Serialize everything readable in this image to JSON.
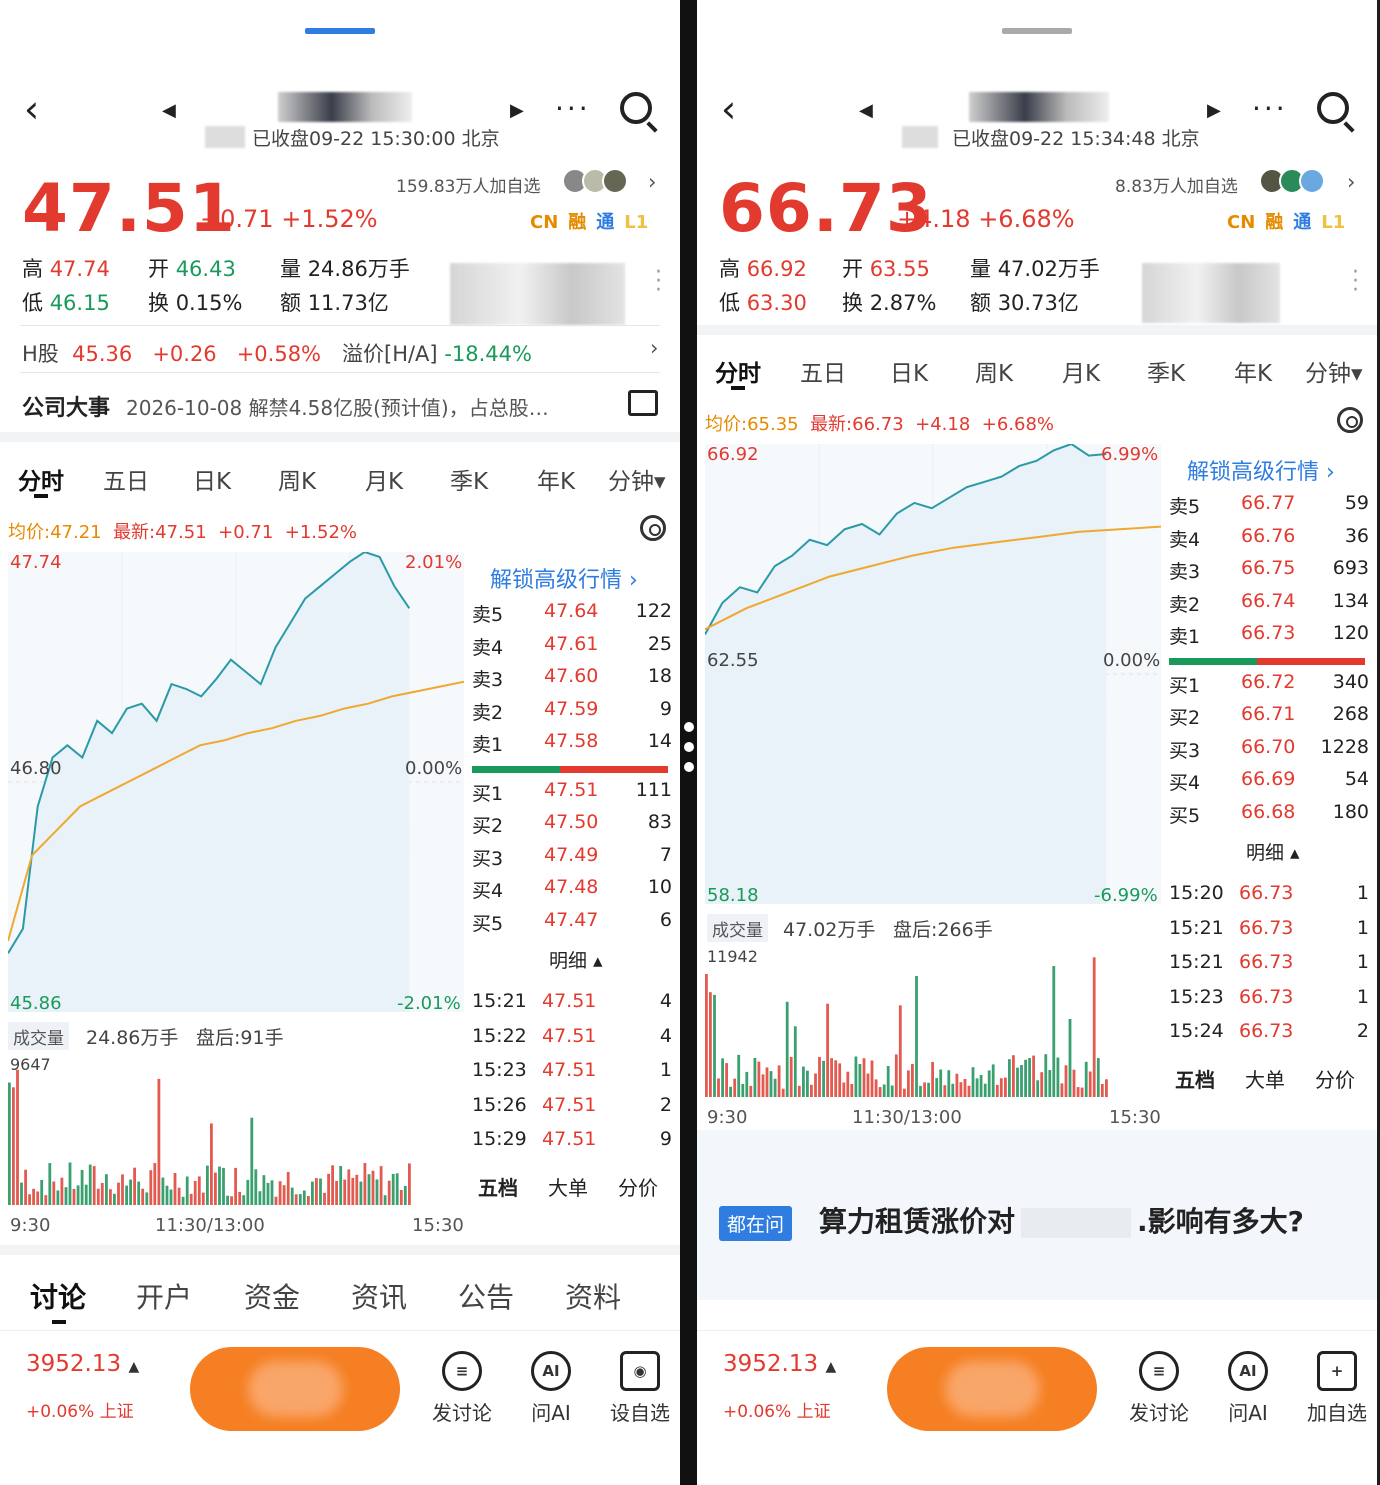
{
  "colors": {
    "up": "#e23a2e",
    "down": "#1a9a5a",
    "accent": "#2f7de1",
    "avg": "#f0a830",
    "price_line": "#2a9aa8",
    "trade_button": "#f57f22"
  },
  "left": {
    "status": "已收盘09-22 15:30:00 北京",
    "price": "47.51",
    "change": "+0.71",
    "change_pct": "+1.52%",
    "followers": "159.83万人加自选",
    "badges": [
      "CN",
      "融",
      "通",
      "L1"
    ],
    "stats": {
      "high_label": "高",
      "high": "47.74",
      "open_label": "开",
      "open": "46.43",
      "vol_label": "量",
      "vol": "24.86万手",
      "low_label": "低",
      "low": "46.15",
      "turn_label": "换",
      "turn": "0.15%",
      "amt_label": "额",
      "amt": "11.73亿"
    },
    "hshare": {
      "label": "H股",
      "price": "45.36",
      "chg": "+0.26",
      "pct": "+0.58%",
      "prem_label": "溢价[H/A]",
      "prem": "-18.44%"
    },
    "event": {
      "label": "公司大事",
      "text": "2026-10-08 解禁4.58亿股(预计值)，占总股…"
    },
    "tabs": [
      "分时",
      "五日",
      "日K",
      "周K",
      "月K",
      "季K",
      "年K",
      "分钟▾"
    ],
    "avgline": {
      "avg": "均价:47.21",
      "latest": "最新:47.51",
      "chg": "+0.71",
      "pct": "+1.52%"
    },
    "axis": {
      "top": "47.74",
      "top_pct": "2.01%",
      "mid": "46.80",
      "mid_pct": "0.00%",
      "bot": "45.86",
      "bot_pct": "-2.01%",
      "vol_label": "成交量",
      "vol": "24.86万手",
      "after": "盘后:91手",
      "vol_max": "9647",
      "t0": "9:30",
      "t1": "11:30/13:00",
      "t2": "15:30"
    },
    "unlock": "解锁高级行情 ›",
    "sells": [
      [
        "卖5",
        "47.64",
        "122"
      ],
      [
        "卖4",
        "47.61",
        "25"
      ],
      [
        "卖3",
        "47.60",
        "18"
      ],
      [
        "卖2",
        "47.59",
        "9"
      ],
      [
        "卖1",
        "47.58",
        "14"
      ]
    ],
    "buys": [
      [
        "买1",
        "47.51",
        "111"
      ],
      [
        "买2",
        "47.50",
        "83"
      ],
      [
        "买3",
        "47.49",
        "7"
      ],
      [
        "买4",
        "47.48",
        "10"
      ],
      [
        "买5",
        "47.47",
        "6"
      ]
    ],
    "detail_label": "明细 ▴",
    "ticks": [
      [
        "15:21",
        "47.51",
        "4"
      ],
      [
        "15:22",
        "47.51",
        "4"
      ],
      [
        "15:23",
        "47.51",
        "1"
      ],
      [
        "15:26",
        "47.51",
        "2"
      ],
      [
        "15:29",
        "47.51",
        "9"
      ]
    ],
    "bottom_tabs": [
      "五档",
      "大单",
      "分价"
    ],
    "section_tabs": [
      "讨论",
      "开户",
      "资金",
      "资讯",
      "公告",
      "资料"
    ],
    "footer": {
      "index": "3952.13",
      "index_chg": "+0.06% 上证",
      "discuss": "发讨论",
      "ai": "问AI",
      "set": "设自选"
    }
  },
  "right": {
    "status": "已收盘09-22 15:34:48 北京",
    "price": "66.73",
    "change": "+4.18",
    "change_pct": "+6.68%",
    "followers": "8.83万人加自选",
    "badges": [
      "CN",
      "融",
      "通",
      "L1"
    ],
    "stats": {
      "high_label": "高",
      "high": "66.92",
      "open_label": "开",
      "open": "63.55",
      "vol_label": "量",
      "vol": "47.02万手",
      "low_label": "低",
      "low": "63.30",
      "turn_label": "换",
      "turn": "2.87%",
      "amt_label": "额",
      "amt": "30.73亿"
    },
    "tabs": [
      "分时",
      "五日",
      "日K",
      "周K",
      "月K",
      "季K",
      "年K",
      "分钟▾"
    ],
    "avgline": {
      "avg": "均价:65.35",
      "latest": "最新:66.73",
      "chg": "+4.18",
      "pct": "+6.68%"
    },
    "axis": {
      "top": "66.92",
      "top_pct": "6.99%",
      "mid": "62.55",
      "mid_pct": "0.00%",
      "bot": "58.18",
      "bot_pct": "-6.99%",
      "vol_label": "成交量",
      "vol": "47.02万手",
      "after": "盘后:266手",
      "vol_max": "11942",
      "t0": "9:30",
      "t1": "11:30/13:00",
      "t2": "15:30"
    },
    "unlock": "解锁高级行情 ›",
    "sells": [
      [
        "卖5",
        "66.77",
        "59"
      ],
      [
        "卖4",
        "66.76",
        "36"
      ],
      [
        "卖3",
        "66.75",
        "693"
      ],
      [
        "卖2",
        "66.74",
        "134"
      ],
      [
        "卖1",
        "66.73",
        "120"
      ]
    ],
    "buys": [
      [
        "买1",
        "66.72",
        "340"
      ],
      [
        "买2",
        "66.71",
        "268"
      ],
      [
        "买3",
        "66.70",
        "1228"
      ],
      [
        "买4",
        "66.69",
        "54"
      ],
      [
        "买5",
        "66.68",
        "180"
      ]
    ],
    "detail_label": "明细 ▴",
    "ticks": [
      [
        "15:20",
        "66.73",
        "1"
      ],
      [
        "15:21",
        "66.73",
        "1"
      ],
      [
        "15:21",
        "66.73",
        "1"
      ],
      [
        "15:23",
        "66.73",
        "1"
      ],
      [
        "15:24",
        "66.73",
        "2"
      ]
    ],
    "bottom_tabs": [
      "五档",
      "大单",
      "分价"
    ],
    "card": {
      "tag": "都在问",
      "text": "算力租赁涨价对",
      "text2": ".影响有多大?"
    },
    "footer": {
      "index": "3952.13",
      "index_chg": "+0.06% 上证",
      "discuss": "发讨论",
      "ai": "问AI",
      "set": "加自选"
    }
  },
  "chart_data": [
    {
      "type": "line",
      "title": "",
      "series": [
        {
          "name": "",
          "values": [
            46.1,
            46.2,
            46.7,
            46.9,
            46.95,
            46.9,
            47.05,
            47.0,
            47.1,
            47.12,
            47.05,
            47.2,
            47.18,
            47.15,
            47.22,
            47.3,
            47.25,
            47.2,
            47.35,
            47.45,
            47.55,
            47.6,
            47.65,
            47.7,
            47.74,
            47.72,
            47.6,
            47.51
          ]
        },
        {
          "name": "",
          "values": [
            46.15,
            46.5,
            46.6,
            46.7,
            46.75,
            46.8,
            46.85,
            46.9,
            46.95,
            46.97,
            47.0,
            47.02,
            47.05,
            47.07,
            47.1,
            47.12,
            47.15,
            47.17,
            47.19,
            47.21
          ]
        }
      ],
      "ylim": [
        45.86,
        47.74
      ]
    },
    {
      "type": "line",
      "title": "",
      "series": [
        {
          "name": "",
          "values": [
            63.3,
            63.9,
            64.2,
            64.1,
            64.6,
            64.8,
            65.1,
            65.0,
            65.3,
            65.4,
            65.2,
            65.6,
            65.8,
            65.7,
            65.9,
            66.1,
            66.2,
            66.3,
            66.5,
            66.6,
            66.8,
            66.92,
            66.7,
            66.73
          ]
        },
        {
          "name": "",
          "values": [
            63.4,
            63.8,
            64.1,
            64.4,
            64.6,
            64.8,
            64.95,
            65.05,
            65.15,
            65.25,
            65.3,
            65.35
          ]
        }
      ],
      "ylim": [
        58.18,
        66.92
      ]
    }
  ]
}
